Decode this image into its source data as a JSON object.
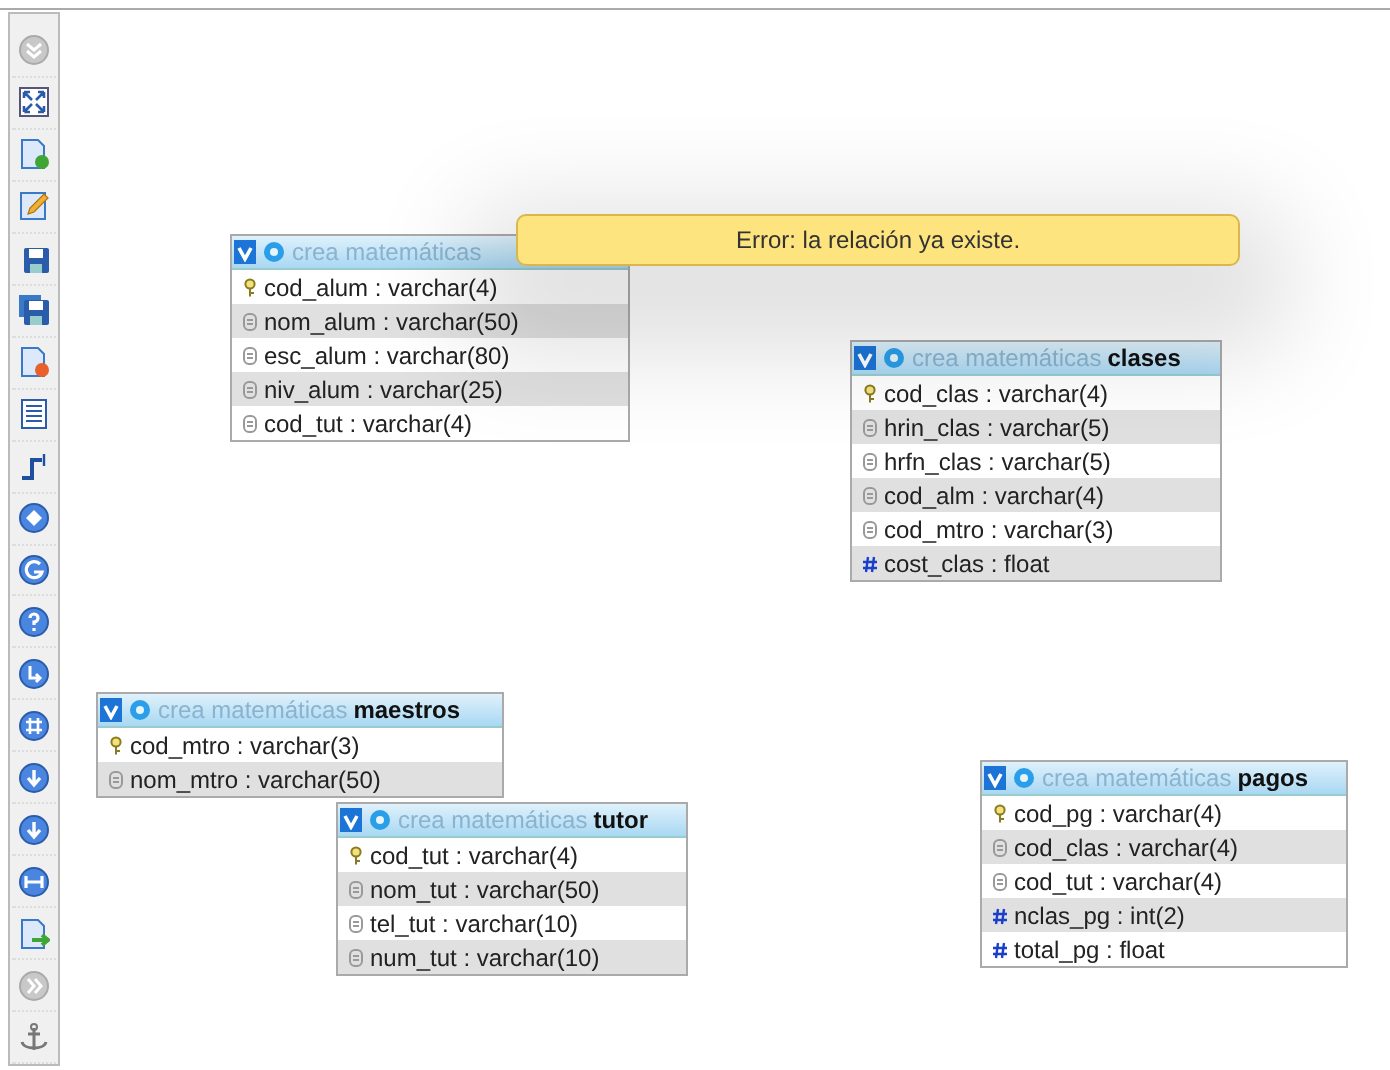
{
  "tables": [
    {
      "database": "crea matemáticas",
      "columns": [
        {
          "kind": "key",
          "text": "cod_alum : varchar(4)"
        },
        {
          "kind": "field",
          "text": "nom_alum : varchar(50)"
        },
        {
          "kind": "field",
          "text": "esc_alum : varchar(80)"
        },
        {
          "kind": "field",
          "text": "niv_alum : varchar(25)"
        },
        {
          "kind": "field",
          "text": "cod_tut : varchar(4)"
        }
      ]
    },
    {
      "database": "crea matemáticas",
      "name": "clases",
      "columns": [
        {
          "kind": "key",
          "text": "cod_clas : varchar(4)"
        },
        {
          "kind": "field",
          "text": "hrin_clas : varchar(5)"
        },
        {
          "kind": "field",
          "text": "hrfn_clas : varchar(5)"
        },
        {
          "kind": "field",
          "text": "cod_alm : varchar(4)"
        },
        {
          "kind": "field",
          "text": "cod_mtro : varchar(3)"
        },
        {
          "kind": "number",
          "text": "cost_clas : float"
        }
      ]
    },
    {
      "database": "crea matemáticas",
      "name": "maestros",
      "columns": [
        {
          "kind": "key",
          "text": "cod_mtro : varchar(3)"
        },
        {
          "kind": "field",
          "text": "nom_mtro : varchar(50)"
        }
      ]
    },
    {
      "database": "crea matemáticas",
      "name": "tutor",
      "columns": [
        {
          "kind": "key",
          "text": "cod_tut : varchar(4)"
        },
        {
          "kind": "field",
          "text": "nom_tut : varchar(50)"
        },
        {
          "kind": "field",
          "text": "tel_tut : varchar(10)"
        },
        {
          "kind": "field",
          "text": "num_tut : varchar(10)"
        }
      ]
    },
    {
      "database": "crea matemáticas",
      "name": "pagos",
      "columns": [
        {
          "kind": "key",
          "text": "cod_pg : varchar(4)"
        },
        {
          "kind": "field",
          "text": "cod_clas : varchar(4)"
        },
        {
          "kind": "field",
          "text": "cod_tut : varchar(4)"
        },
        {
          "kind": "number",
          "text": "nclas_pg : int(2)"
        },
        {
          "kind": "number",
          "text": "total_pg : float"
        }
      ]
    }
  ],
  "error_message": "Error: la relación ya existe."
}
